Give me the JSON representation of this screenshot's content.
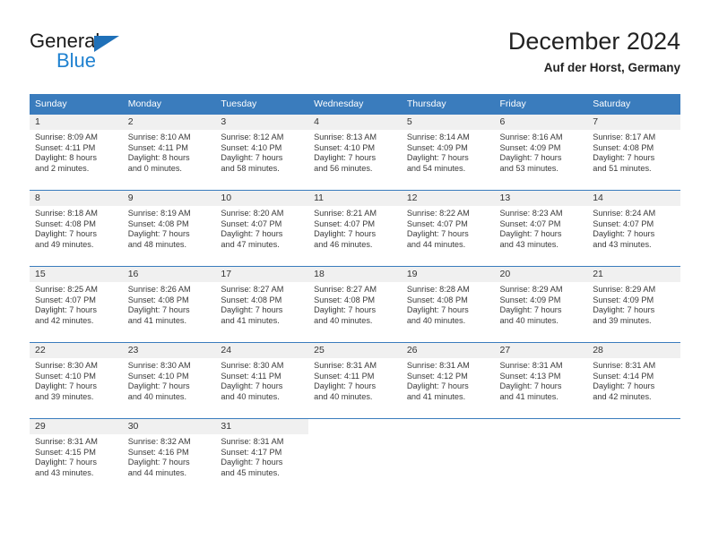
{
  "brand": {
    "name_part1": "General",
    "name_part2": "Blue",
    "triangle_icon": "triangle-icon",
    "colors": {
      "triangle": "#1f70b8",
      "blue_text": "#1f81d0",
      "dark_text": "#1a1a1a"
    }
  },
  "header": {
    "title": "December 2024",
    "subtitle": "Auf der Horst, Germany"
  },
  "theme": {
    "header_bg": "#3a7cbd",
    "header_text": "#ffffff",
    "daynum_band_bg": "#f0f0f0",
    "row_separator": "#3a7cbd",
    "body_text": "#3a3a3a"
  },
  "weekday_headers": [
    "Sunday",
    "Monday",
    "Tuesday",
    "Wednesday",
    "Thursday",
    "Friday",
    "Saturday"
  ],
  "weeks": [
    [
      {
        "day": "1",
        "sunrise": "Sunrise: 8:09 AM",
        "sunset": "Sunset: 4:11 PM",
        "daylight_line1": "Daylight: 8 hours",
        "daylight_line2": "and 2 minutes."
      },
      {
        "day": "2",
        "sunrise": "Sunrise: 8:10 AM",
        "sunset": "Sunset: 4:11 PM",
        "daylight_line1": "Daylight: 8 hours",
        "daylight_line2": "and 0 minutes."
      },
      {
        "day": "3",
        "sunrise": "Sunrise: 8:12 AM",
        "sunset": "Sunset: 4:10 PM",
        "daylight_line1": "Daylight: 7 hours",
        "daylight_line2": "and 58 minutes."
      },
      {
        "day": "4",
        "sunrise": "Sunrise: 8:13 AM",
        "sunset": "Sunset: 4:10 PM",
        "daylight_line1": "Daylight: 7 hours",
        "daylight_line2": "and 56 minutes."
      },
      {
        "day": "5",
        "sunrise": "Sunrise: 8:14 AM",
        "sunset": "Sunset: 4:09 PM",
        "daylight_line1": "Daylight: 7 hours",
        "daylight_line2": "and 54 minutes."
      },
      {
        "day": "6",
        "sunrise": "Sunrise: 8:16 AM",
        "sunset": "Sunset: 4:09 PM",
        "daylight_line1": "Daylight: 7 hours",
        "daylight_line2": "and 53 minutes."
      },
      {
        "day": "7",
        "sunrise": "Sunrise: 8:17 AM",
        "sunset": "Sunset: 4:08 PM",
        "daylight_line1": "Daylight: 7 hours",
        "daylight_line2": "and 51 minutes."
      }
    ],
    [
      {
        "day": "8",
        "sunrise": "Sunrise: 8:18 AM",
        "sunset": "Sunset: 4:08 PM",
        "daylight_line1": "Daylight: 7 hours",
        "daylight_line2": "and 49 minutes."
      },
      {
        "day": "9",
        "sunrise": "Sunrise: 8:19 AM",
        "sunset": "Sunset: 4:08 PM",
        "daylight_line1": "Daylight: 7 hours",
        "daylight_line2": "and 48 minutes."
      },
      {
        "day": "10",
        "sunrise": "Sunrise: 8:20 AM",
        "sunset": "Sunset: 4:07 PM",
        "daylight_line1": "Daylight: 7 hours",
        "daylight_line2": "and 47 minutes."
      },
      {
        "day": "11",
        "sunrise": "Sunrise: 8:21 AM",
        "sunset": "Sunset: 4:07 PM",
        "daylight_line1": "Daylight: 7 hours",
        "daylight_line2": "and 46 minutes."
      },
      {
        "day": "12",
        "sunrise": "Sunrise: 8:22 AM",
        "sunset": "Sunset: 4:07 PM",
        "daylight_line1": "Daylight: 7 hours",
        "daylight_line2": "and 44 minutes."
      },
      {
        "day": "13",
        "sunrise": "Sunrise: 8:23 AM",
        "sunset": "Sunset: 4:07 PM",
        "daylight_line1": "Daylight: 7 hours",
        "daylight_line2": "and 43 minutes."
      },
      {
        "day": "14",
        "sunrise": "Sunrise: 8:24 AM",
        "sunset": "Sunset: 4:07 PM",
        "daylight_line1": "Daylight: 7 hours",
        "daylight_line2": "and 43 minutes."
      }
    ],
    [
      {
        "day": "15",
        "sunrise": "Sunrise: 8:25 AM",
        "sunset": "Sunset: 4:07 PM",
        "daylight_line1": "Daylight: 7 hours",
        "daylight_line2": "and 42 minutes."
      },
      {
        "day": "16",
        "sunrise": "Sunrise: 8:26 AM",
        "sunset": "Sunset: 4:08 PM",
        "daylight_line1": "Daylight: 7 hours",
        "daylight_line2": "and 41 minutes."
      },
      {
        "day": "17",
        "sunrise": "Sunrise: 8:27 AM",
        "sunset": "Sunset: 4:08 PM",
        "daylight_line1": "Daylight: 7 hours",
        "daylight_line2": "and 41 minutes."
      },
      {
        "day": "18",
        "sunrise": "Sunrise: 8:27 AM",
        "sunset": "Sunset: 4:08 PM",
        "daylight_line1": "Daylight: 7 hours",
        "daylight_line2": "and 40 minutes."
      },
      {
        "day": "19",
        "sunrise": "Sunrise: 8:28 AM",
        "sunset": "Sunset: 4:08 PM",
        "daylight_line1": "Daylight: 7 hours",
        "daylight_line2": "and 40 minutes."
      },
      {
        "day": "20",
        "sunrise": "Sunrise: 8:29 AM",
        "sunset": "Sunset: 4:09 PM",
        "daylight_line1": "Daylight: 7 hours",
        "daylight_line2": "and 40 minutes."
      },
      {
        "day": "21",
        "sunrise": "Sunrise: 8:29 AM",
        "sunset": "Sunset: 4:09 PM",
        "daylight_line1": "Daylight: 7 hours",
        "daylight_line2": "and 39 minutes."
      }
    ],
    [
      {
        "day": "22",
        "sunrise": "Sunrise: 8:30 AM",
        "sunset": "Sunset: 4:10 PM",
        "daylight_line1": "Daylight: 7 hours",
        "daylight_line2": "and 39 minutes."
      },
      {
        "day": "23",
        "sunrise": "Sunrise: 8:30 AM",
        "sunset": "Sunset: 4:10 PM",
        "daylight_line1": "Daylight: 7 hours",
        "daylight_line2": "and 40 minutes."
      },
      {
        "day": "24",
        "sunrise": "Sunrise: 8:30 AM",
        "sunset": "Sunset: 4:11 PM",
        "daylight_line1": "Daylight: 7 hours",
        "daylight_line2": "and 40 minutes."
      },
      {
        "day": "25",
        "sunrise": "Sunrise: 8:31 AM",
        "sunset": "Sunset: 4:11 PM",
        "daylight_line1": "Daylight: 7 hours",
        "daylight_line2": "and 40 minutes."
      },
      {
        "day": "26",
        "sunrise": "Sunrise: 8:31 AM",
        "sunset": "Sunset: 4:12 PM",
        "daylight_line1": "Daylight: 7 hours",
        "daylight_line2": "and 41 minutes."
      },
      {
        "day": "27",
        "sunrise": "Sunrise: 8:31 AM",
        "sunset": "Sunset: 4:13 PM",
        "daylight_line1": "Daylight: 7 hours",
        "daylight_line2": "and 41 minutes."
      },
      {
        "day": "28",
        "sunrise": "Sunrise: 8:31 AM",
        "sunset": "Sunset: 4:14 PM",
        "daylight_line1": "Daylight: 7 hours",
        "daylight_line2": "and 42 minutes."
      }
    ],
    [
      {
        "day": "29",
        "sunrise": "Sunrise: 8:31 AM",
        "sunset": "Sunset: 4:15 PM",
        "daylight_line1": "Daylight: 7 hours",
        "daylight_line2": "and 43 minutes."
      },
      {
        "day": "30",
        "sunrise": "Sunrise: 8:32 AM",
        "sunset": "Sunset: 4:16 PM",
        "daylight_line1": "Daylight: 7 hours",
        "daylight_line2": "and 44 minutes."
      },
      {
        "day": "31",
        "sunrise": "Sunrise: 8:31 AM",
        "sunset": "Sunset: 4:17 PM",
        "daylight_line1": "Daylight: 7 hours",
        "daylight_line2": "and 45 minutes."
      },
      {
        "day": "",
        "sunrise": "",
        "sunset": "",
        "daylight_line1": "",
        "daylight_line2": ""
      },
      {
        "day": "",
        "sunrise": "",
        "sunset": "",
        "daylight_line1": "",
        "daylight_line2": ""
      },
      {
        "day": "",
        "sunrise": "",
        "sunset": "",
        "daylight_line1": "",
        "daylight_line2": ""
      },
      {
        "day": "",
        "sunrise": "",
        "sunset": "",
        "daylight_line1": "",
        "daylight_line2": ""
      }
    ]
  ]
}
